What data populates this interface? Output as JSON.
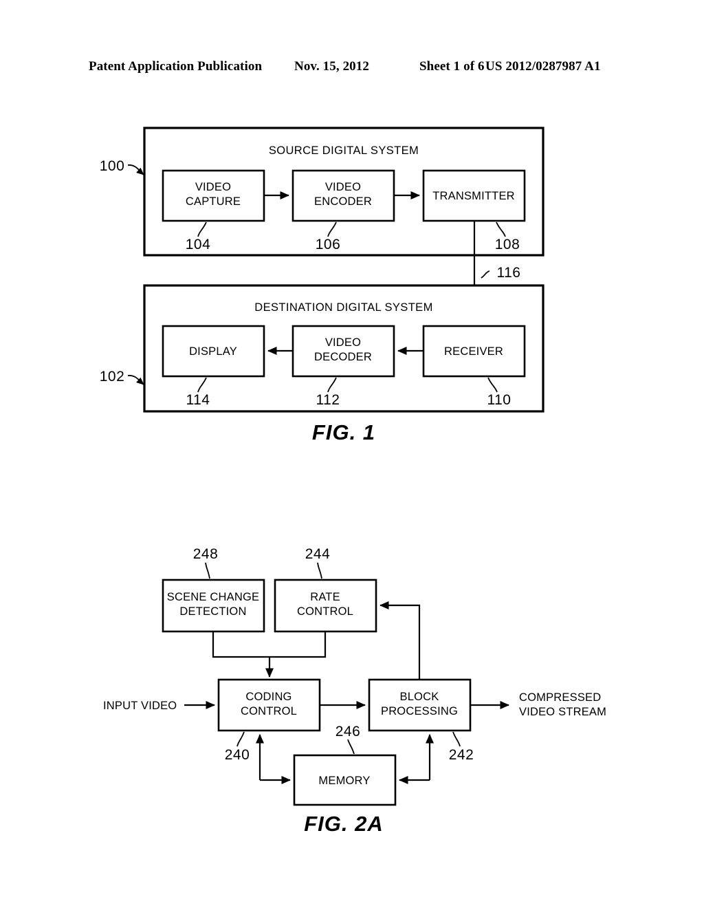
{
  "header": {
    "publication": "Patent Application Publication",
    "date": "Nov. 15, 2012",
    "sheet": "Sheet 1 of 6",
    "doc_number": "US 2012/0287987 A1"
  },
  "figures": [
    {
      "caption": "FIG. 1",
      "systems": [
        {
          "title": "SOURCE DIGITAL SYSTEM",
          "ref": "100",
          "blocks": [
            {
              "label_line1": "VIDEO",
              "label_line2": "CAPTURE",
              "ref": "104"
            },
            {
              "label_line1": "VIDEO",
              "label_line2": "ENCODER",
              "ref": "106"
            },
            {
              "label_line1": "TRANSMITTER",
              "label_line2": "",
              "ref": "108"
            }
          ]
        },
        {
          "title": "DESTINATION DIGITAL SYSTEM",
          "ref": "102",
          "blocks": [
            {
              "label_line1": "DISPLAY",
              "label_line2": "",
              "ref": "114"
            },
            {
              "label_line1": "VIDEO",
              "label_line2": "DECODER",
              "ref": "112"
            },
            {
              "label_line1": "RECEIVER",
              "label_line2": "",
              "ref": "110"
            }
          ]
        }
      ],
      "channel_ref": "116"
    },
    {
      "caption": "FIG. 2A",
      "blocks": [
        {
          "label_line1": "SCENE CHANGE",
          "label_line2": "DETECTION",
          "ref": "248"
        },
        {
          "label_line1": "RATE",
          "label_line2": "CONTROL",
          "ref": "244"
        },
        {
          "label_line1": "CODING",
          "label_line2": "CONTROL",
          "ref": "240"
        },
        {
          "label_line1": "BLOCK",
          "label_line2": "PROCESSING",
          "ref": "242"
        },
        {
          "label_line1": "MEMORY",
          "label_line2": "",
          "ref": "246"
        }
      ],
      "io": {
        "input_label": "INPUT VIDEO",
        "output_line1": "COMPRESSED",
        "output_line2": "VIDEO STREAM"
      }
    }
  ],
  "colors": {
    "ink": "#000000",
    "paper": "#ffffff"
  }
}
